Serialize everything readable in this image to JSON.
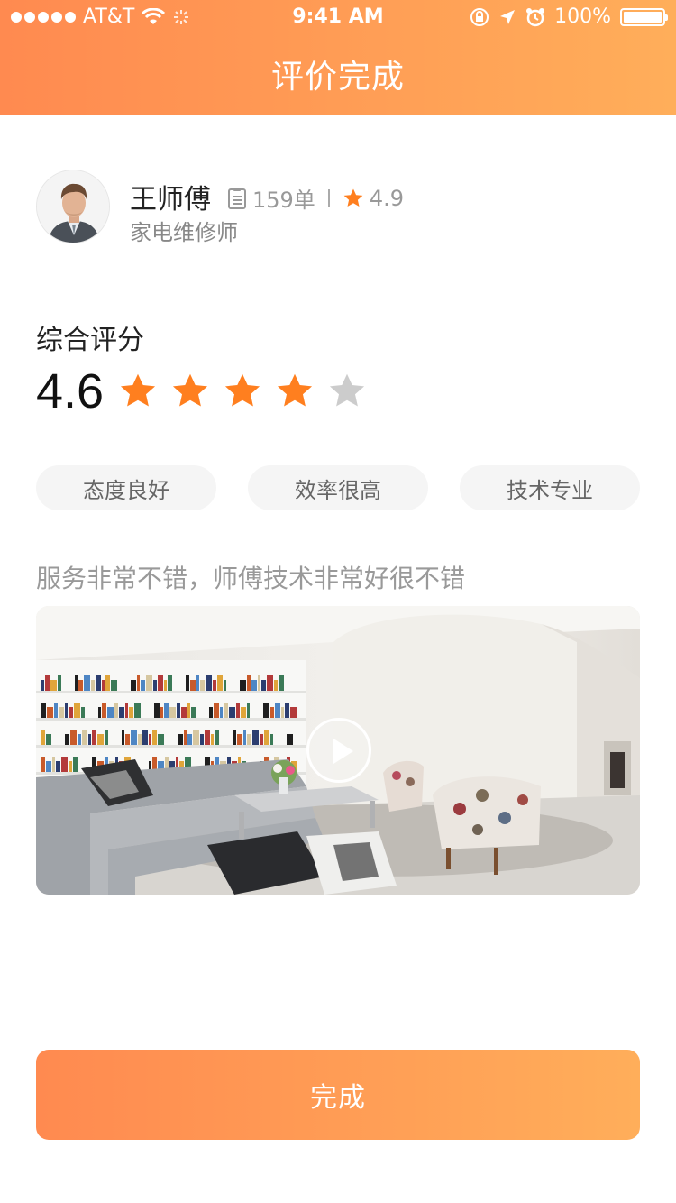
{
  "status_bar": {
    "carrier": "AT&T",
    "time": "9:41 AM",
    "battery": "100%"
  },
  "nav": {
    "title": "评价完成"
  },
  "technician": {
    "name": "王师傅",
    "orders": "159单",
    "rating": "4.9",
    "role": "家电维修师"
  },
  "score": {
    "label": "综合评分",
    "value": "4.6",
    "stars_filled": 4,
    "stars_total": 5
  },
  "tags": [
    {
      "label": "态度良好"
    },
    {
      "label": "效率很高"
    },
    {
      "label": "技术专业"
    }
  ],
  "comment": "服务非常不错，师傅技术非常好很不错",
  "done_label": "完成",
  "colors": {
    "accent_start": "#ff8a50",
    "accent_end": "#ffae5a",
    "star_active": "#ff7f1f",
    "star_inactive": "#cccccc"
  },
  "icons": [
    "signal-dots-icon",
    "wifi-icon",
    "activity-icon",
    "lock-rotation-icon",
    "location-arrow-icon",
    "alarm-icon",
    "battery-icon",
    "order-list-icon",
    "star-icon",
    "play-icon"
  ]
}
